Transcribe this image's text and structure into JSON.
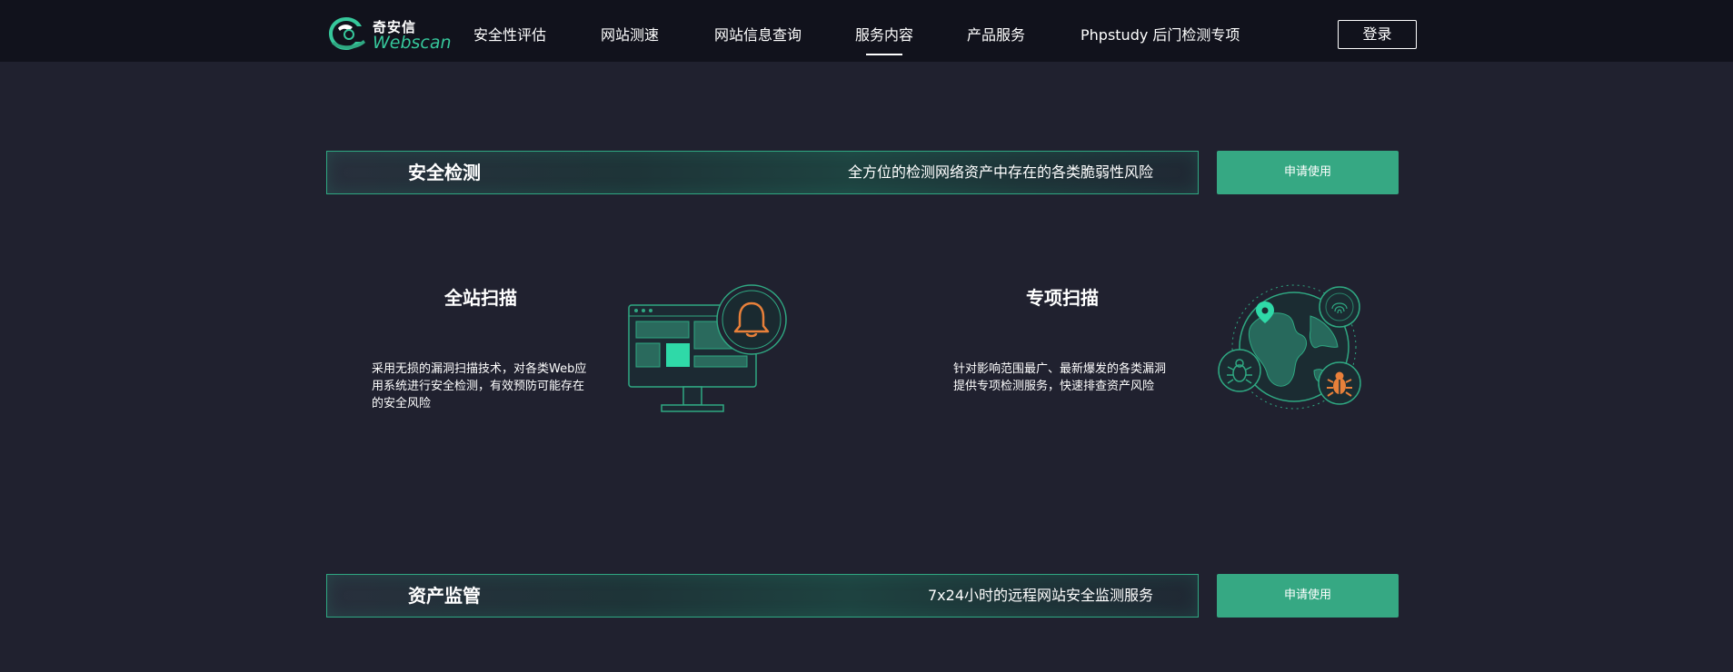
{
  "brand": {
    "name_cn": "奇安信",
    "name_en": "Webscan"
  },
  "nav": {
    "items": [
      {
        "label": "安全性评估"
      },
      {
        "label": "网站测速"
      },
      {
        "label": "网站信息查询"
      },
      {
        "label": "服务内容",
        "active": true
      },
      {
        "label": "产品服务"
      },
      {
        "label": "Phpstudy 后门检测专项"
      }
    ],
    "login_label": "登录"
  },
  "sections": [
    {
      "title": "安全检测",
      "description": "全方位的检测网络资产中存在的各类脆弱性风险",
      "apply_label": "申请使用"
    },
    {
      "title": "资产监管",
      "description": "7x24小时的远程网站安全监测服务",
      "apply_label": "申请使用"
    }
  ],
  "features": [
    {
      "title": "全站扫描",
      "description": "采用无损的漏洞扫描技术，对各类Web应用系统进行安全检测，有效预防可能存在的安全风险",
      "icon": "monitor-bell-icon"
    },
    {
      "title": "专项扫描",
      "description": "针对影响范围最广、最新爆发的各类漏洞提供专项检测服务，快速排查资产风险",
      "icon": "globe-bug-icon"
    }
  ],
  "colors": {
    "background": "#20212f",
    "header": "#11121c",
    "accent": "#36a883",
    "alert": "#e8803a"
  }
}
